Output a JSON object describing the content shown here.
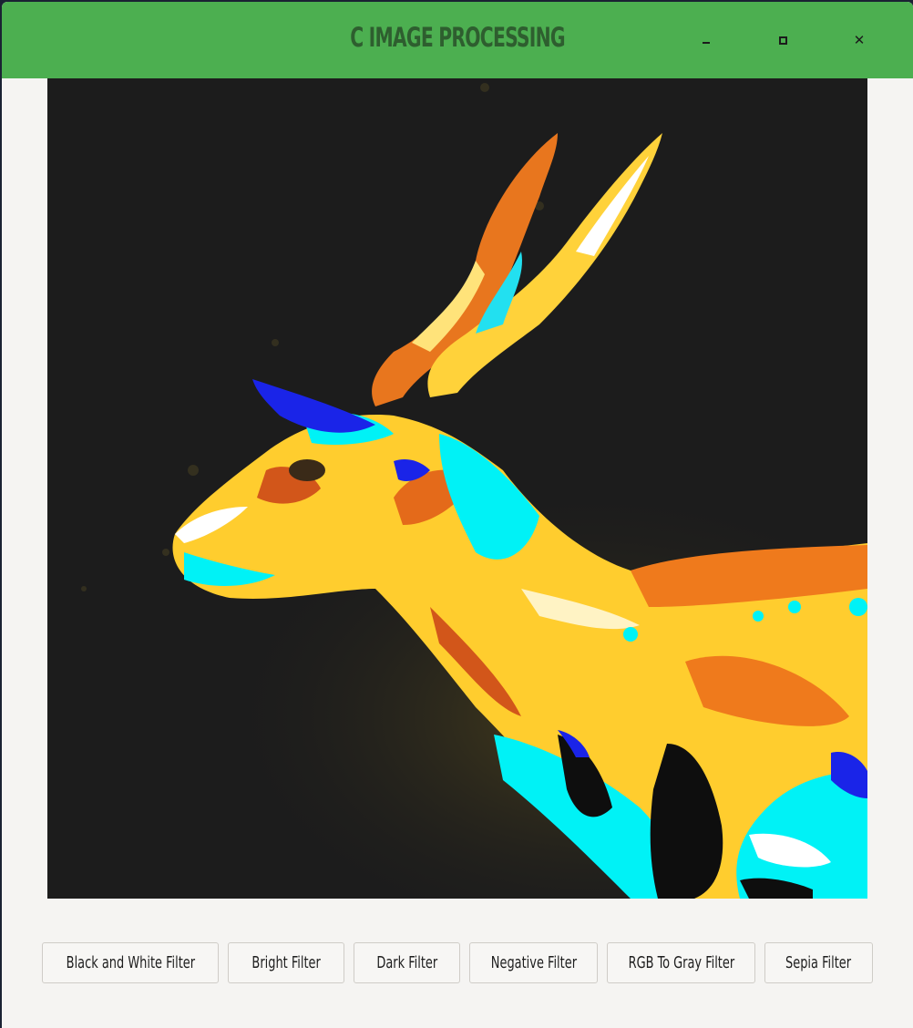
{
  "window": {
    "title": "C IMAGE PROCESSING",
    "controls": {
      "minimize": "minimize-icon",
      "maximize": "maximize-icon",
      "close": "close-icon"
    },
    "accent_color": "#4caf50"
  },
  "image": {
    "description_icon": "image-preview"
  },
  "filters": [
    "Black and White Filter",
    "Bright Filter",
    "Dark Filter",
    "Negative Filter",
    "RGB To Gray Filter",
    "Sepia Filter"
  ]
}
